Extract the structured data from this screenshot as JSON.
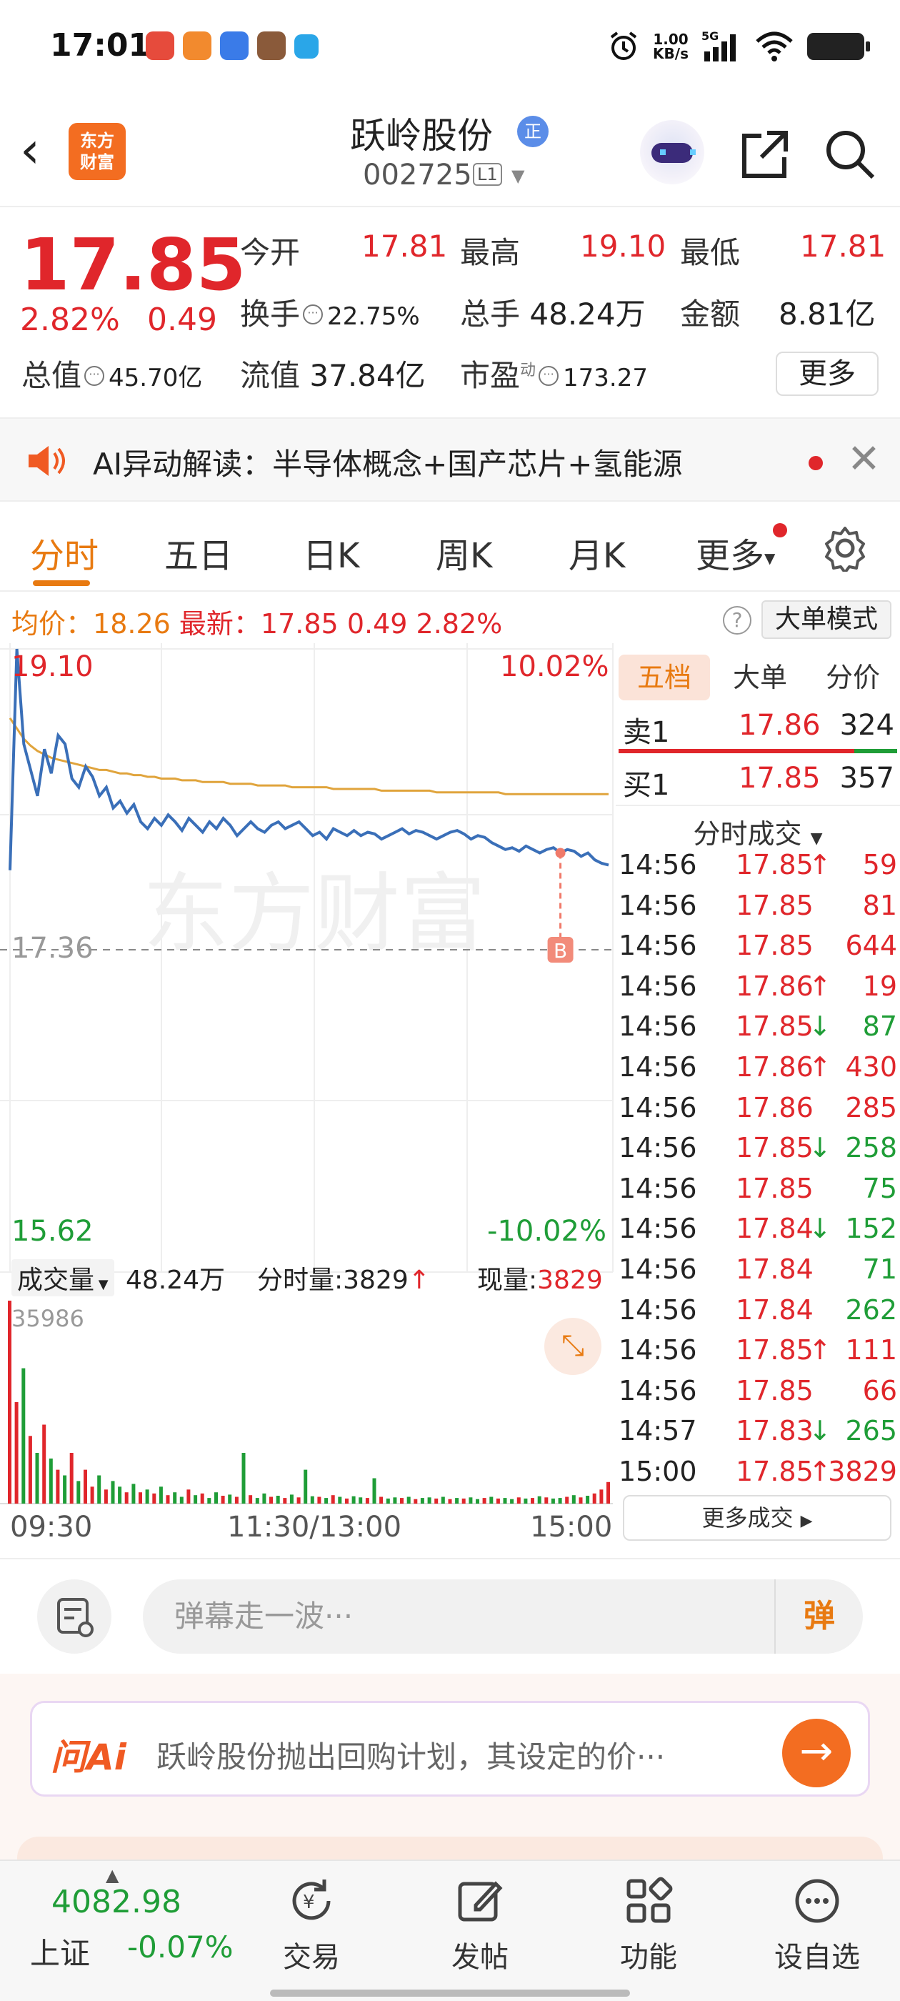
{
  "status_bar": {
    "time": "17:01",
    "net_speed_value": "1.00",
    "net_speed_unit": "KB/s",
    "signal_label": "5G"
  },
  "header": {
    "brand_line1": "东方",
    "brand_line2": "财富",
    "stock_name": "跃岭股份",
    "tag": "正",
    "stock_code": "002725",
    "level": "L1"
  },
  "quote": {
    "last_price": "17.85",
    "pct_change": "2.82%",
    "abs_change": "0.49",
    "open_label": "今开",
    "open": "17.81",
    "high_label": "最高",
    "high": "19.10",
    "low_label": "最低",
    "low": "17.81",
    "turnover_rate_label": "换手",
    "turnover_rate": "22.75%",
    "volume_label": "总手",
    "volume": "48.24万",
    "amount_label": "金额",
    "amount": "8.81亿",
    "total_cap_label": "总值",
    "total_cap": "45.70亿",
    "float_cap_label": "流值",
    "float_cap": "37.84亿",
    "pe_label": "市盈",
    "pe_sup": "动",
    "pe": "173.27",
    "more_button": "更多"
  },
  "ai_banner": {
    "text": "AI异动解读：半导体概念+国产芯片+氢能源"
  },
  "tabs": [
    "分时",
    "五日",
    "日K",
    "周K",
    "月K",
    "更多"
  ],
  "info_line": {
    "avg_label": "均价：",
    "avg_value": "18.26",
    "latest_label": "最新：",
    "latest_value": "17.85",
    "change": "0.49",
    "pct": "2.82%",
    "big_order_mode": "大单模式"
  },
  "chart_data": {
    "type": "line",
    "title": "",
    "y_max_label": "19.10",
    "y_max_pct": "10.02%",
    "y_min_label": "15.62",
    "y_min_pct": "-10.02%",
    "prev_close_label": "17.36",
    "watermark": "东方财富",
    "buy_marker": "B",
    "ylim": [
      15.62,
      19.1
    ],
    "prev_close": 17.36,
    "series": [
      {
        "name": "",
        "color": "#3a6fb8",
        "values": [
          17.82,
          19.1,
          18.55,
          18.4,
          18.25,
          18.52,
          18.38,
          18.6,
          18.55,
          18.35,
          18.3,
          18.42,
          18.36,
          18.25,
          18.3,
          18.18,
          18.22,
          18.15,
          18.2,
          18.1,
          18.06,
          18.12,
          18.08,
          18.14,
          18.1,
          18.05,
          18.12,
          18.08,
          18.04,
          18.1,
          18.06,
          18.12,
          18.08,
          18.02,
          18.06,
          18.1,
          18.06,
          18.04,
          18.08,
          18.1,
          18.06,
          18.08,
          18.1,
          18.06,
          18.02,
          18.04,
          18.0,
          18.06,
          18.04,
          18.02,
          18.05,
          18.02,
          18.04,
          18.03,
          18.0,
          18.02,
          18.04,
          18.06,
          18.03,
          18.05,
          18.04,
          18.02,
          18.0,
          18.02,
          18.04,
          18.05,
          18.03,
          18.0,
          18.02,
          18.01,
          17.98,
          17.96,
          17.94,
          17.95,
          17.93,
          17.96,
          17.94,
          17.92,
          17.94,
          17.95,
          17.92,
          17.94,
          17.93,
          17.9,
          17.92,
          17.88,
          17.86,
          17.85
        ]
      },
      {
        "name": "",
        "color": "#e0a43c",
        "values": [
          18.7,
          18.64,
          18.58,
          18.54,
          18.51,
          18.49,
          18.47,
          18.46,
          18.45,
          18.44,
          18.43,
          18.42,
          18.41,
          18.4,
          18.4,
          18.39,
          18.38,
          18.38,
          18.37,
          18.37,
          18.36,
          18.36,
          18.35,
          18.35,
          18.35,
          18.34,
          18.34,
          18.34,
          18.33,
          18.33,
          18.33,
          18.33,
          18.32,
          18.32,
          18.32,
          18.32,
          18.31,
          18.31,
          18.31,
          18.31,
          18.31,
          18.3,
          18.3,
          18.3,
          18.3,
          18.3,
          18.3,
          18.29,
          18.29,
          18.29,
          18.29,
          18.29,
          18.29,
          18.29,
          18.28,
          18.28,
          18.28,
          18.28,
          18.28,
          18.28,
          18.28,
          18.28,
          18.27,
          18.27,
          18.27,
          18.27,
          18.27,
          18.27,
          18.27,
          18.27,
          18.27,
          18.27,
          18.26,
          18.26,
          18.26,
          18.26,
          18.26,
          18.26,
          18.26,
          18.26,
          18.26,
          18.26,
          18.26,
          18.26,
          18.26,
          18.26,
          18.26,
          18.26
        ]
      }
    ],
    "x_labels": [
      "09:30",
      "11:30/13:00",
      "15:00"
    ],
    "volume": {
      "selector": "成交量",
      "total": "48.24万",
      "minute_label": "分时量:",
      "minute_value": "3829",
      "current_label": "现量:",
      "current_value": "3829",
      "max_label": "35986",
      "max": 35986,
      "bars": [
        35986,
        18000,
        24000,
        12000,
        9000,
        14000,
        8000,
        6000,
        5000,
        9000,
        4000,
        6000,
        3000,
        5000,
        2500,
        4000,
        3000,
        2000,
        3500,
        2000,
        2500,
        1800,
        3000,
        1500,
        2000,
        1200,
        2500,
        1500,
        1800,
        1000,
        2000,
        1400,
        1600,
        1200,
        9000,
        1500,
        1000,
        1800,
        1200,
        1400,
        1000,
        1600,
        1100,
        6000,
        1300,
        1200,
        1000,
        1500,
        1200,
        900,
        1300,
        1100,
        1000,
        4500,
        1200,
        900,
        1100,
        1000,
        1200,
        800,
        1000,
        1100,
        900,
        1200,
        800,
        1000,
        900,
        1100,
        800,
        1000,
        1200,
        900,
        1000,
        800,
        1100,
        900,
        1000,
        1300,
        1100,
        900,
        1000,
        1200,
        1500,
        1100,
        1400,
        1800,
        2500,
        3829
      ],
      "bar_colors": [
        "r",
        "r",
        "g",
        "r",
        "g",
        "r",
        "g",
        "r",
        "g",
        "r",
        "g",
        "r",
        "r",
        "g",
        "r",
        "g",
        "g",
        "r",
        "g",
        "r",
        "g",
        "r",
        "g",
        "r",
        "g",
        "g",
        "r",
        "g",
        "r",
        "g",
        "g",
        "r",
        "g",
        "r",
        "g",
        "r",
        "g",
        "g",
        "r",
        "g",
        "r",
        "g",
        "r",
        "g",
        "g",
        "r",
        "g",
        "r",
        "g",
        "r",
        "g",
        "g",
        "r",
        "g",
        "r",
        "g",
        "g",
        "r",
        "g",
        "r",
        "g",
        "g",
        "r",
        "g",
        "r",
        "g",
        "r",
        "g",
        "g",
        "r",
        "g",
        "r",
        "g",
        "g",
        "r",
        "g",
        "r",
        "g",
        "r",
        "g",
        "g",
        "r",
        "g",
        "r",
        "g",
        "r",
        "r",
        "r"
      ]
    }
  },
  "order_book": {
    "tabs": [
      "五档",
      "大单",
      "分价"
    ],
    "ask1": {
      "label": "卖1",
      "price": "17.86",
      "volume": "324"
    },
    "bid1": {
      "label": "买1",
      "price": "17.85",
      "volume": "357"
    },
    "ticks_header": "分时成交",
    "ticks": [
      {
        "time": "14:56",
        "price": "17.85",
        "arrow": "↑",
        "vol": "59",
        "dir": "up"
      },
      {
        "time": "14:56",
        "price": "17.85",
        "arrow": "",
        "vol": "81",
        "dir": "up"
      },
      {
        "time": "14:56",
        "price": "17.85",
        "arrow": "",
        "vol": "644",
        "dir": "up"
      },
      {
        "time": "14:56",
        "price": "17.86",
        "arrow": "↑",
        "vol": "19",
        "dir": "up"
      },
      {
        "time": "14:56",
        "price": "17.85",
        "arrow": "↓",
        "vol": "87",
        "dir": "down"
      },
      {
        "time": "14:56",
        "price": "17.86",
        "arrow": "↑",
        "vol": "430",
        "dir": "up"
      },
      {
        "time": "14:56",
        "price": "17.86",
        "arrow": "",
        "vol": "285",
        "dir": "up"
      },
      {
        "time": "14:56",
        "price": "17.85",
        "arrow": "↓",
        "vol": "258",
        "dir": "down"
      },
      {
        "time": "14:56",
        "price": "17.85",
        "arrow": "",
        "vol": "75",
        "dir": "down"
      },
      {
        "time": "14:56",
        "price": "17.84",
        "arrow": "↓",
        "vol": "152",
        "dir": "down"
      },
      {
        "time": "14:56",
        "price": "17.84",
        "arrow": "",
        "vol": "71",
        "dir": "down"
      },
      {
        "time": "14:56",
        "price": "17.84",
        "arrow": "",
        "vol": "262",
        "dir": "down"
      },
      {
        "time": "14:56",
        "price": "17.85",
        "arrow": "↑",
        "vol": "111",
        "dir": "up"
      },
      {
        "time": "14:56",
        "price": "17.85",
        "arrow": "",
        "vol": "66",
        "dir": "up"
      },
      {
        "time": "14:57",
        "price": "17.83",
        "arrow": "↓",
        "vol": "265",
        "dir": "down"
      },
      {
        "time": "15:00",
        "price": "17.85",
        "arrow": "↑",
        "vol": "3829",
        "dir": "up"
      }
    ],
    "more_trades": "更多成交"
  },
  "comment_bar": {
    "placeholder": "弹幕走一波···",
    "button": "弹"
  },
  "ask_ai": {
    "logo": "问Ai",
    "text": "跃岭股份抛出回购计划，其设定的价···"
  },
  "bottom_nav": {
    "index_value": "4082.98",
    "index_name": "上证",
    "index_change": "-0.07%",
    "items": [
      "交易",
      "发帖",
      "功能",
      "设自选"
    ]
  },
  "colors": {
    "up": "#e0262b",
    "down": "#1f9d37",
    "accent": "#e87a11",
    "price_line": "#3a6fb8",
    "avg_line": "#e0a43c"
  }
}
